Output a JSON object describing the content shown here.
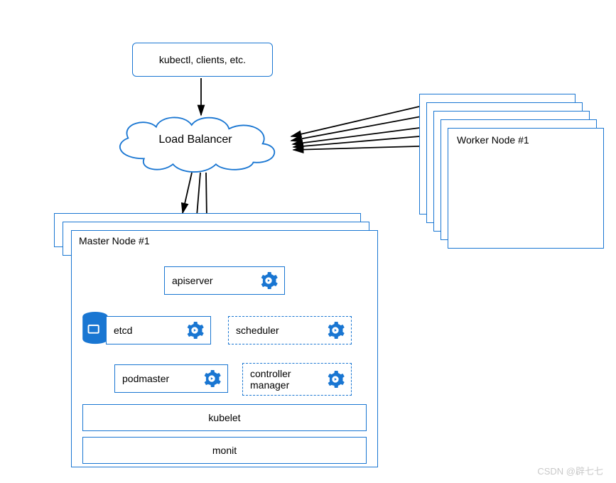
{
  "clients_box": {
    "label": "kubectl, clients, etc."
  },
  "load_balancer": {
    "label": "Load Balancer"
  },
  "master_stack": {
    "title": "Master Node #1",
    "components": {
      "apiserver": "apiserver",
      "etcd": "etcd",
      "scheduler": "scheduler",
      "podmaster": "podmaster",
      "controller_manager_line1": "controller",
      "controller_manager_line2": "manager"
    },
    "bars": {
      "kubelet": "kubelet",
      "monit": "monit"
    }
  },
  "worker_stack": {
    "title": "Worker Node #1"
  },
  "watermark": "CSDN @辟七七",
  "colors": {
    "primary": "#1976d2",
    "text": "#000000"
  }
}
